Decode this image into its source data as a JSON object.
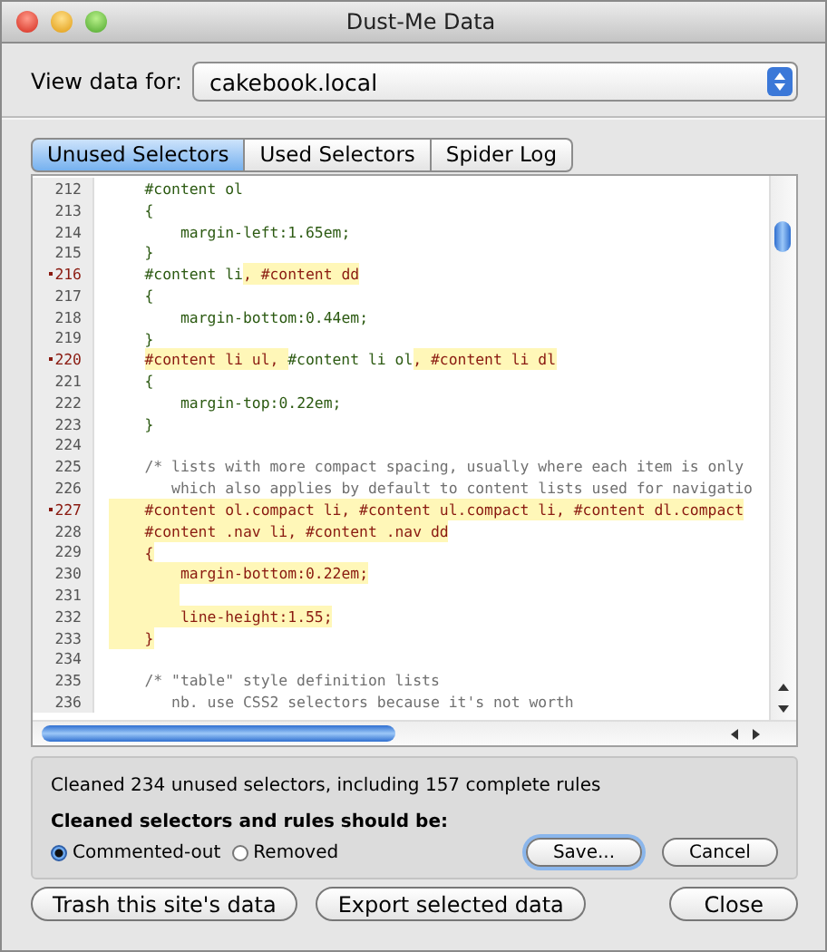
{
  "window": {
    "title": "Dust-Me Data"
  },
  "site": {
    "label": "View data for:",
    "value": "cakebook.local"
  },
  "tabs": [
    {
      "label": "Unused Selectors",
      "selected": true
    },
    {
      "label": "Used Selectors",
      "selected": false
    },
    {
      "label": "Spider Log",
      "selected": false
    }
  ],
  "code_lines": [
    {
      "number": "212",
      "marked": false,
      "kind": "rule",
      "highlighted": false,
      "segments": [
        {
          "text": "#content ol",
          "kind": "used"
        }
      ]
    },
    {
      "number": "213",
      "marked": false,
      "kind": "rule",
      "highlighted": false,
      "segments": [
        {
          "text": "{",
          "kind": "used"
        }
      ]
    },
    {
      "number": "214",
      "marked": false,
      "kind": "property",
      "highlighted": false,
      "segments": [
        {
          "text": "margin-left:1.65em;",
          "kind": "used"
        }
      ]
    },
    {
      "number": "215",
      "marked": false,
      "kind": "rule",
      "highlighted": false,
      "segments": [
        {
          "text": "}",
          "kind": "used"
        }
      ]
    },
    {
      "number": "216",
      "marked": true,
      "kind": "rule",
      "highlighted": false,
      "segments": [
        {
          "text": "#content li",
          "kind": "used"
        },
        {
          "text": ", #content dd",
          "kind": "unused"
        }
      ]
    },
    {
      "number": "217",
      "marked": false,
      "kind": "rule",
      "highlighted": false,
      "segments": [
        {
          "text": "{",
          "kind": "used"
        }
      ]
    },
    {
      "number": "218",
      "marked": false,
      "kind": "property",
      "highlighted": false,
      "segments": [
        {
          "text": "margin-bottom:0.44em;",
          "kind": "used"
        }
      ]
    },
    {
      "number": "219",
      "marked": false,
      "kind": "rule",
      "highlighted": false,
      "segments": [
        {
          "text": "}",
          "kind": "used"
        }
      ]
    },
    {
      "number": "220",
      "marked": true,
      "kind": "rule",
      "highlighted": false,
      "segments": [
        {
          "text": "#content li ul, ",
          "kind": "unused"
        },
        {
          "text": "#content li ol",
          "kind": "used"
        },
        {
          "text": ", #content li dl",
          "kind": "unused"
        }
      ]
    },
    {
      "number": "221",
      "marked": false,
      "kind": "rule",
      "highlighted": false,
      "segments": [
        {
          "text": "{",
          "kind": "used"
        }
      ]
    },
    {
      "number": "222",
      "marked": false,
      "kind": "property",
      "highlighted": false,
      "segments": [
        {
          "text": "margin-top:0.22em;",
          "kind": "used"
        }
      ]
    },
    {
      "number": "223",
      "marked": false,
      "kind": "rule",
      "highlighted": false,
      "segments": [
        {
          "text": "}",
          "kind": "used"
        }
      ]
    },
    {
      "number": "224",
      "marked": false,
      "kind": "rule",
      "highlighted": false
    },
    {
      "number": "225",
      "marked": false,
      "kind": "rule",
      "highlighted": false,
      "segments": [
        {
          "text": "/* lists with more compact spacing, usually where each item is only",
          "kind": "comment"
        }
      ]
    },
    {
      "number": "226",
      "marked": false,
      "kind": "continuation",
      "highlighted": false,
      "segments": [
        {
          "text": "which also applies by default to content lists used for navigatio",
          "kind": "comment"
        }
      ]
    },
    {
      "number": "227",
      "marked": true,
      "kind": "rule",
      "highlighted": true,
      "segments": [
        {
          "text": "#content ol.compact li, #content ul.compact li, #content dl.compact",
          "kind": "unused"
        }
      ]
    },
    {
      "number": "228",
      "marked": false,
      "kind": "rule",
      "highlighted": true,
      "segments": [
        {
          "text": "#content .nav li, #content .nav dd",
          "kind": "unused"
        }
      ]
    },
    {
      "number": "229",
      "marked": false,
      "kind": "rule",
      "highlighted": true,
      "segments": [
        {
          "text": "{",
          "kind": "unused"
        }
      ]
    },
    {
      "number": "230",
      "marked": false,
      "kind": "property",
      "highlighted": true,
      "segments": [
        {
          "text": "margin-bottom:0.22em;",
          "kind": "unused"
        }
      ]
    },
    {
      "number": "231",
      "marked": false,
      "kind": "property",
      "highlighted": true
    },
    {
      "number": "232",
      "marked": false,
      "kind": "property",
      "highlighted": true,
      "segments": [
        {
          "text": "line-height:1.55;",
          "kind": "unused"
        }
      ]
    },
    {
      "number": "233",
      "marked": false,
      "kind": "rule",
      "highlighted": true,
      "segments": [
        {
          "text": "}",
          "kind": "unused"
        }
      ]
    },
    {
      "number": "234",
      "marked": false,
      "kind": "rule",
      "highlighted": false
    },
    {
      "number": "235",
      "marked": false,
      "kind": "rule",
      "highlighted": false,
      "segments": [
        {
          "text": "/* \"table\" style definition lists",
          "kind": "comment"
        }
      ]
    },
    {
      "number": "236",
      "marked": false,
      "kind": "continuation",
      "highlighted": false,
      "segments": [
        {
          "text": "nb. use CSS2 selectors because it's not worth",
          "kind": "comment"
        }
      ]
    }
  ],
  "summary": "Cleaned 234 unused selectors, including 157 complete rules",
  "mode": {
    "label": "Cleaned selectors and rules should be:",
    "options": [
      {
        "label": "Commented-out",
        "selected": true
      },
      {
        "label": "Removed",
        "selected": false
      }
    ]
  },
  "panel_buttons": [
    {
      "label": "Save...",
      "default": true
    },
    {
      "label": "Cancel",
      "default": false
    }
  ],
  "footer_buttons": [
    "Trash this site's data",
    "Export selected data",
    "Close"
  ]
}
